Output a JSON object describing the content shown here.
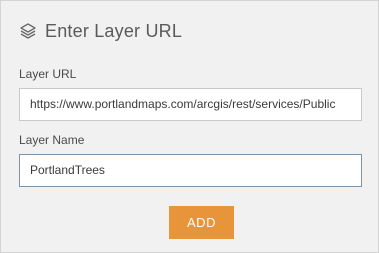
{
  "header": {
    "icon": "layers-icon",
    "title": "Enter Layer URL"
  },
  "layer_url": {
    "label": "Layer URL",
    "value": "https://www.portlandmaps.com/arcgis/rest/services/Public"
  },
  "layer_name": {
    "label": "Layer Name",
    "value": "PortlandTrees"
  },
  "actions": {
    "add_label": "ADD"
  },
  "colors": {
    "panel_bg": "#f1f1f1",
    "accent": "#e8943a",
    "focus_border": "#7a96ad"
  }
}
